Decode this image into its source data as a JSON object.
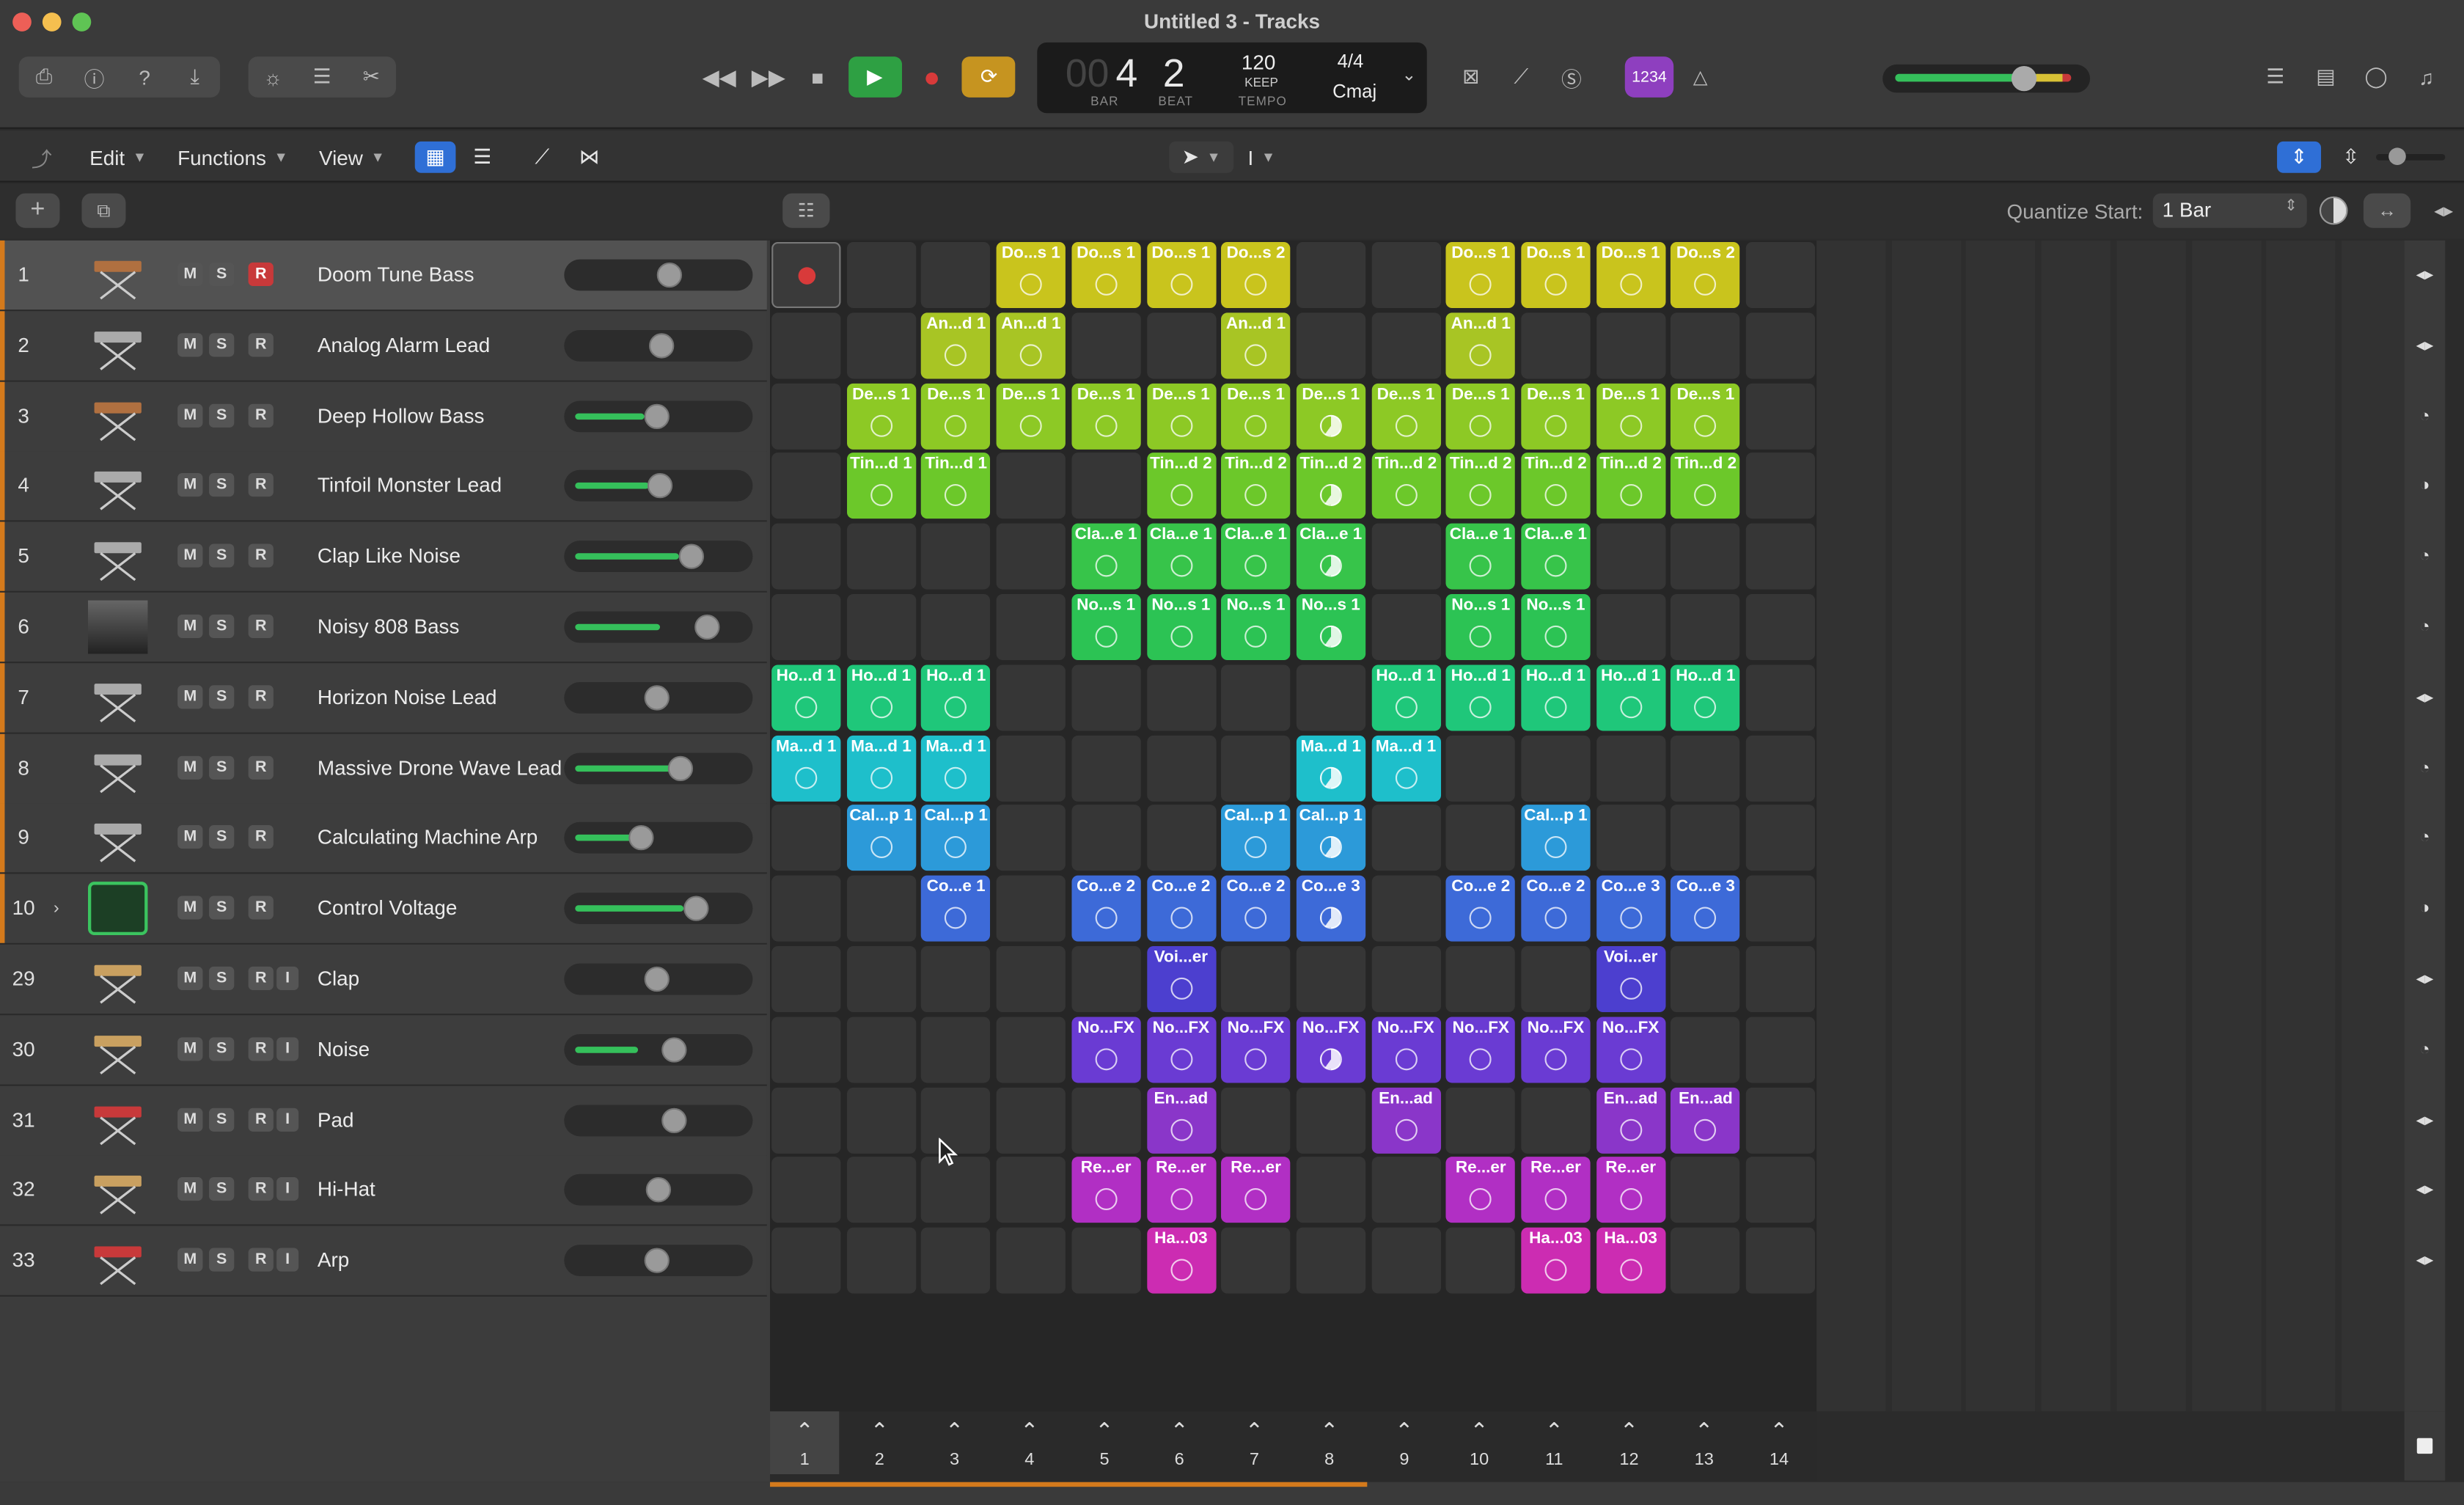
{
  "window": {
    "title": "Untitled 3 - Tracks"
  },
  "transport": {
    "bar_digits_dim": "00",
    "bar": "4",
    "beat": "2",
    "bar_label": "BAR",
    "beat_label": "BEAT",
    "tempo": "120",
    "tempo_keep": "KEEP",
    "tempo_label": "TEMPO",
    "time_sig": "4/4",
    "key": "Cmaj",
    "badge": "1234"
  },
  "toolbar": {
    "edit": "Edit",
    "functions": "Functions",
    "view": "View"
  },
  "subbar": {
    "quantize_label": "Quantize Start:",
    "quantize_value": "1 Bar"
  },
  "colors": {
    "accent_record": "#c8393a",
    "play_green": "#2ea043",
    "cycle_yellow": "#c69420",
    "badge_purple": "#8e3fbf"
  },
  "tracks": [
    {
      "num": "1",
      "name": "Doom Tune Bass",
      "rec": true,
      "fill": 0,
      "knob": 0.57,
      "icon": "synth-keyboard-icon",
      "selected": true
    },
    {
      "num": "2",
      "name": "Analog Alarm Lead",
      "rec": false,
      "fill": 0,
      "knob": 0.52,
      "icon": "keyboard-stand-icon"
    },
    {
      "num": "3",
      "name": "Deep Hollow Bass",
      "rec": false,
      "fill": 0.42,
      "knob": 0.49,
      "icon": "synth-keyboard-icon"
    },
    {
      "num": "4",
      "name": "Tinfoil Monster Lead",
      "rec": false,
      "fill": 0.45,
      "knob": 0.51,
      "icon": "keyboard-stand-icon"
    },
    {
      "num": "5",
      "name": "Clap Like Noise",
      "rec": false,
      "fill": 0.63,
      "knob": 0.7,
      "icon": "keyboard-stand-icon"
    },
    {
      "num": "6",
      "name": "Noisy 808 Bass",
      "rec": false,
      "fill": 0.52,
      "knob": 0.8,
      "icon": "drum-machine-icon"
    },
    {
      "num": "7",
      "name": "Horizon Noise Lead",
      "rec": false,
      "fill": 0,
      "knob": 0.49,
      "icon": "keyboard-stand-icon"
    },
    {
      "num": "8",
      "name": "Massive Drone Wave Lead",
      "rec": false,
      "fill": 0.6,
      "knob": 0.63,
      "icon": "keyboard-stand-icon"
    },
    {
      "num": "9",
      "name": "Calculating Machine Arp",
      "rec": false,
      "fill": 0.36,
      "knob": 0.39,
      "icon": "keyboard-stand-icon"
    },
    {
      "num": "10",
      "name": "Control Voltage",
      "rec": false,
      "fill": 0.66,
      "knob": 0.73,
      "icon": "modular-icon",
      "expand": true
    },
    {
      "num": "29",
      "name": "Clap",
      "rec": false,
      "fill": 0,
      "knob": 0.49,
      "icon": "snare-drum-icon",
      "input": true
    },
    {
      "num": "30",
      "name": "Noise",
      "rec": false,
      "fill": 0.38,
      "knob": 0.6,
      "icon": "bongos-icon",
      "input": true
    },
    {
      "num": "31",
      "name": "Pad",
      "rec": false,
      "fill": 0,
      "knob": 0.6,
      "icon": "red-keyboard-icon",
      "input": true
    },
    {
      "num": "32",
      "name": "Hi-Hat",
      "rec": false,
      "fill": 0,
      "knob": 0.5,
      "icon": "bongos-icon",
      "input": true
    },
    {
      "num": "33",
      "name": "Arp",
      "rec": false,
      "fill": 0,
      "knob": 0.49,
      "icon": "red-keyboard-icon",
      "input": true
    }
  ],
  "track_labels": {
    "m": "M",
    "s": "S",
    "r": "R",
    "i": "I"
  },
  "clips": [
    {
      "row": 0,
      "col": 3,
      "label": "Do...s 1",
      "color": "#c9c41d"
    },
    {
      "row": 0,
      "col": 4,
      "label": "Do...s 1",
      "color": "#c9c41d"
    },
    {
      "row": 0,
      "col": 5,
      "label": "Do...s 1",
      "color": "#c9c41d"
    },
    {
      "row": 0,
      "col": 6,
      "label": "Do...s 2",
      "color": "#c9c41d"
    },
    {
      "row": 0,
      "col": 9,
      "label": "Do...s 1",
      "color": "#c9c41d"
    },
    {
      "row": 0,
      "col": 10,
      "label": "Do...s 1",
      "color": "#c9c41d"
    },
    {
      "row": 0,
      "col": 11,
      "label": "Do...s 1",
      "color": "#c9c41d"
    },
    {
      "row": 0,
      "col": 12,
      "label": "Do...s 2",
      "color": "#c9c41d"
    },
    {
      "row": 1,
      "col": 2,
      "label": "An...d 1",
      "color": "#a8c524"
    },
    {
      "row": 1,
      "col": 3,
      "label": "An...d 1",
      "color": "#a8c524"
    },
    {
      "row": 1,
      "col": 6,
      "label": "An...d 1",
      "color": "#a8c524"
    },
    {
      "row": 1,
      "col": 9,
      "label": "An...d 1",
      "color": "#a8c524"
    },
    {
      "row": 2,
      "col": 1,
      "label": "De...s 1",
      "color": "#8dc925"
    },
    {
      "row": 2,
      "col": 2,
      "label": "De...s 1",
      "color": "#8dc925"
    },
    {
      "row": 2,
      "col": 3,
      "label": "De...s 1",
      "color": "#8dc925"
    },
    {
      "row": 2,
      "col": 4,
      "label": "De...s 1",
      "color": "#8dc925"
    },
    {
      "row": 2,
      "col": 5,
      "label": "De...s 1",
      "color": "#8dc925"
    },
    {
      "row": 2,
      "col": 6,
      "label": "De...s 1",
      "color": "#8dc925"
    },
    {
      "row": 2,
      "col": 7,
      "label": "De...s 1",
      "color": "#8dc925",
      "playing": true
    },
    {
      "row": 2,
      "col": 8,
      "label": "De...s 1",
      "color": "#8dc925"
    },
    {
      "row": 2,
      "col": 9,
      "label": "De...s 1",
      "color": "#8dc925"
    },
    {
      "row": 2,
      "col": 10,
      "label": "De...s 1",
      "color": "#8dc925"
    },
    {
      "row": 2,
      "col": 11,
      "label": "De...s 1",
      "color": "#8dc925"
    },
    {
      "row": 2,
      "col": 12,
      "label": "De...s 1",
      "color": "#8dc925"
    },
    {
      "row": 3,
      "col": 1,
      "label": "Tin...d 1",
      "color": "#6cc82a"
    },
    {
      "row": 3,
      "col": 2,
      "label": "Tin...d 1",
      "color": "#6cc82a"
    },
    {
      "row": 3,
      "col": 5,
      "label": "Tin...d 2",
      "color": "#6cc82a"
    },
    {
      "row": 3,
      "col": 6,
      "label": "Tin...d 2",
      "color": "#6cc82a"
    },
    {
      "row": 3,
      "col": 7,
      "label": "Tin...d 2",
      "color": "#6cc82a",
      "playing": true
    },
    {
      "row": 3,
      "col": 8,
      "label": "Tin...d 2",
      "color": "#6cc82a"
    },
    {
      "row": 3,
      "col": 9,
      "label": "Tin...d 2",
      "color": "#6cc82a"
    },
    {
      "row": 3,
      "col": 10,
      "label": "Tin...d 2",
      "color": "#6cc82a"
    },
    {
      "row": 3,
      "col": 11,
      "label": "Tin...d 2",
      "color": "#6cc82a"
    },
    {
      "row": 3,
      "col": 12,
      "label": "Tin...d 2",
      "color": "#6cc82a"
    },
    {
      "row": 4,
      "col": 4,
      "label": "Cla...e 1",
      "color": "#37c44a"
    },
    {
      "row": 4,
      "col": 5,
      "label": "Cla...e 1",
      "color": "#37c44a"
    },
    {
      "row": 4,
      "col": 6,
      "label": "Cla...e 1",
      "color": "#37c44a"
    },
    {
      "row": 4,
      "col": 7,
      "label": "Cla...e 1",
      "color": "#37c44a",
      "playing": true
    },
    {
      "row": 4,
      "col": 9,
      "label": "Cla...e 1",
      "color": "#37c44a"
    },
    {
      "row": 4,
      "col": 10,
      "label": "Cla...e 1",
      "color": "#37c44a"
    },
    {
      "row": 5,
      "col": 4,
      "label": "No...s 1",
      "color": "#2cc354"
    },
    {
      "row": 5,
      "col": 5,
      "label": "No...s 1",
      "color": "#2cc354"
    },
    {
      "row": 5,
      "col": 6,
      "label": "No...s 1",
      "color": "#2cc354"
    },
    {
      "row": 5,
      "col": 7,
      "label": "No...s 1",
      "color": "#2cc354",
      "playing": true
    },
    {
      "row": 5,
      "col": 9,
      "label": "No...s 1",
      "color": "#2cc354"
    },
    {
      "row": 5,
      "col": 10,
      "label": "No...s 1",
      "color": "#2cc354"
    },
    {
      "row": 6,
      "col": 0,
      "label": "Ho...d 1",
      "color": "#1fc77a"
    },
    {
      "row": 6,
      "col": 1,
      "label": "Ho...d 1",
      "color": "#1fc77a"
    },
    {
      "row": 6,
      "col": 2,
      "label": "Ho...d 1",
      "color": "#1fc77a"
    },
    {
      "row": 6,
      "col": 8,
      "label": "Ho...d 1",
      "color": "#1fc77a"
    },
    {
      "row": 6,
      "col": 9,
      "label": "Ho...d 1",
      "color": "#1fc77a"
    },
    {
      "row": 6,
      "col": 10,
      "label": "Ho...d 1",
      "color": "#1fc77a"
    },
    {
      "row": 6,
      "col": 11,
      "label": "Ho...d 1",
      "color": "#1fc77a"
    },
    {
      "row": 6,
      "col": 12,
      "label": "Ho...d 1",
      "color": "#1fc77a"
    },
    {
      "row": 7,
      "col": 0,
      "label": "Ma...d 1",
      "color": "#1ebfcb"
    },
    {
      "row": 7,
      "col": 1,
      "label": "Ma...d 1",
      "color": "#1ebfcb"
    },
    {
      "row": 7,
      "col": 2,
      "label": "Ma...d 1",
      "color": "#1ebfcb"
    },
    {
      "row": 7,
      "col": 7,
      "label": "Ma...d 1",
      "color": "#1ebfcb",
      "playing": true
    },
    {
      "row": 7,
      "col": 8,
      "label": "Ma...d 1",
      "color": "#1ebfcb"
    },
    {
      "row": 8,
      "col": 1,
      "label": "Cal...p 1",
      "color": "#2c9ad9"
    },
    {
      "row": 8,
      "col": 2,
      "label": "Cal...p 1",
      "color": "#2c9ad9"
    },
    {
      "row": 8,
      "col": 6,
      "label": "Cal...p 1",
      "color": "#2c9ad9"
    },
    {
      "row": 8,
      "col": 7,
      "label": "Cal...p 1",
      "color": "#2c9ad9",
      "playing": true
    },
    {
      "row": 8,
      "col": 10,
      "label": "Cal...p 1",
      "color": "#2c9ad9"
    },
    {
      "row": 9,
      "col": 2,
      "label": "Co...e 1",
      "color": "#3d6ad8"
    },
    {
      "row": 9,
      "col": 4,
      "label": "Co...e 2",
      "color": "#3d6ad8"
    },
    {
      "row": 9,
      "col": 5,
      "label": "Co...e 2",
      "color": "#3d6ad8"
    },
    {
      "row": 9,
      "col": 6,
      "label": "Co...e 2",
      "color": "#3d6ad8"
    },
    {
      "row": 9,
      "col": 7,
      "label": "Co...e 3",
      "color": "#3d6ad8",
      "playing": true
    },
    {
      "row": 9,
      "col": 9,
      "label": "Co...e 2",
      "color": "#3d6ad8"
    },
    {
      "row": 9,
      "col": 10,
      "label": "Co...e 2",
      "color": "#3d6ad8"
    },
    {
      "row": 9,
      "col": 11,
      "label": "Co...e 3",
      "color": "#3d6ad8"
    },
    {
      "row": 9,
      "col": 12,
      "label": "Co...e 3",
      "color": "#3d6ad8"
    },
    {
      "row": 10,
      "col": 5,
      "label": "Voi...er",
      "color": "#4c3fcf"
    },
    {
      "row": 10,
      "col": 11,
      "label": "Voi...er",
      "color": "#4c3fcf"
    },
    {
      "row": 11,
      "col": 4,
      "label": "No...FX",
      "color": "#6a3bd3"
    },
    {
      "row": 11,
      "col": 5,
      "label": "No...FX",
      "color": "#6a3bd3"
    },
    {
      "row": 11,
      "col": 6,
      "label": "No...FX",
      "color": "#6a3bd3"
    },
    {
      "row": 11,
      "col": 7,
      "label": "No...FX",
      "color": "#6a3bd3",
      "playing": true
    },
    {
      "row": 11,
      "col": 8,
      "label": "No...FX",
      "color": "#6a3bd3"
    },
    {
      "row": 11,
      "col": 9,
      "label": "No...FX",
      "color": "#6a3bd3"
    },
    {
      "row": 11,
      "col": 10,
      "label": "No...FX",
      "color": "#6a3bd3"
    },
    {
      "row": 11,
      "col": 11,
      "label": "No...FX",
      "color": "#6a3bd3"
    },
    {
      "row": 12,
      "col": 5,
      "label": "En...ad",
      "color": "#8a36c9"
    },
    {
      "row": 12,
      "col": 8,
      "label": "En...ad",
      "color": "#8a36c9"
    },
    {
      "row": 12,
      "col": 11,
      "label": "En...ad",
      "color": "#8a36c9"
    },
    {
      "row": 12,
      "col": 12,
      "label": "En...ad",
      "color": "#8a36c9"
    },
    {
      "row": 13,
      "col": 4,
      "label": "Re...er",
      "color": "#b12fc4"
    },
    {
      "row": 13,
      "col": 5,
      "label": "Re...er",
      "color": "#b12fc4"
    },
    {
      "row": 13,
      "col": 6,
      "label": "Re...er",
      "color": "#b12fc4"
    },
    {
      "row": 13,
      "col": 9,
      "label": "Re...er",
      "color": "#b12fc4"
    },
    {
      "row": 13,
      "col": 10,
      "label": "Re...er",
      "color": "#b12fc4"
    },
    {
      "row": 13,
      "col": 11,
      "label": "Re...er",
      "color": "#b12fc4"
    },
    {
      "row": 14,
      "col": 5,
      "label": "Ha...03",
      "color": "#cc2cb2"
    },
    {
      "row": 14,
      "col": 10,
      "label": "Ha...03",
      "color": "#cc2cb2"
    },
    {
      "row": 14,
      "col": 11,
      "label": "Ha...03",
      "color": "#cc2cb2"
    }
  ],
  "scenes": [
    "1",
    "2",
    "3",
    "4",
    "5",
    "6",
    "7",
    "8",
    "9",
    "10",
    "11",
    "12",
    "13",
    "14"
  ],
  "right_strip_icons": [
    "split-arrow-icon",
    "split-arrow-icon",
    "half-circle-icon",
    "dark-half-icon",
    "half-circle-icon",
    "half-circle-icon",
    "split-arrow-icon",
    "half-circle-icon",
    "half-circle-icon",
    "dark-half-icon",
    "split-arrow-icon",
    "half-circle-icon",
    "split-arrow-icon",
    "split-arrow-icon",
    "split-arrow-icon"
  ]
}
